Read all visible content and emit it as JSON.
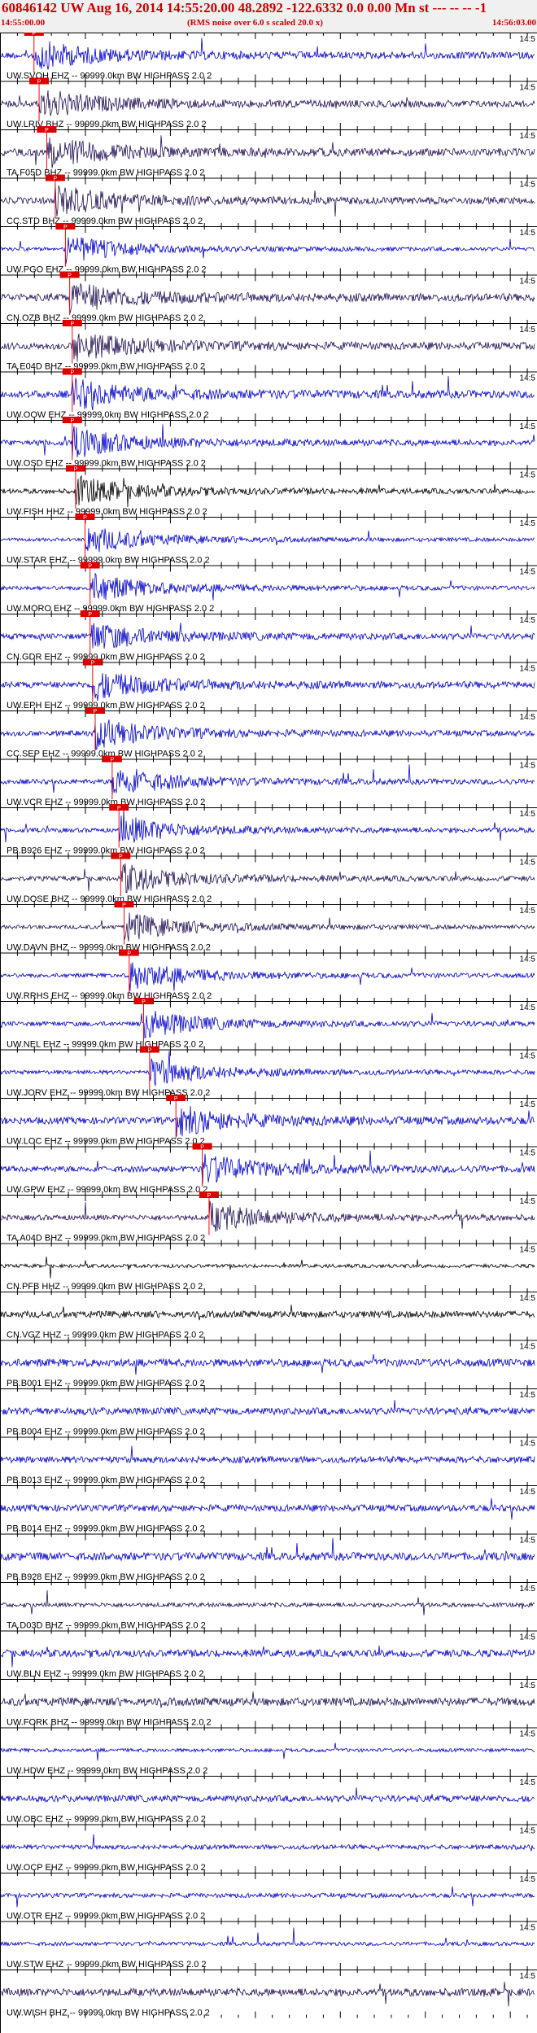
{
  "header": {
    "title": "60846142 UW Aug 16, 2014 14:55:20.00   48.2892 -122.6332  0.0 0.00 Mn st --- -- --  -1",
    "start_time": "14:55:00.00",
    "end_time": "14:56:03.00",
    "noise_note": "(RMS noise over 6.0 s scaled 20.0 x)"
  },
  "chart_data": {
    "type": "line",
    "title": "60846142 UW Aug 16, 2014 14:55:20.00   48.2892 -122.6332  0.0 0.00 Mn st --- -- --  -1",
    "x_range_seconds": [
      0,
      63
    ],
    "tick_label_right": "14:5",
    "filter": "HIGHPASS  2.0  2",
    "series": [
      {
        "label": "UW.SVOH EHZ -- 99999.0km BW  HIGHPASS  2.0  2",
        "color": "#0000cc",
        "pick_s": 4.0,
        "pick_label": "P"
      },
      {
        "label": "UW.LRIV BHZ -- 99999.0km BW  HIGHPASS  2.0  2",
        "color": "#221155",
        "pick_s": 4.6,
        "pick_label": "P"
      },
      {
        "label": "TA.F05D BHZ -- 99999.0km BW  HIGHPASS  2.0  2",
        "color": "#221155",
        "pick_s": 5.5,
        "pick_label": "P"
      },
      {
        "label": "CC.STD BHZ -- 99999.0km BW  HIGHPASS  2.0  2",
        "color": "#221155",
        "pick_s": 6.5,
        "pick_label": "P"
      },
      {
        "label": "UW.PGO EHZ -- 99999.0km BW  HIGHPASS  2.0  2",
        "color": "#0000cc",
        "pick_s": 7.7,
        "pick_label": "P"
      },
      {
        "label": "CN.OZB BHZ -- 99999.0km BW  HIGHPASS  2.0  2",
        "color": "#221155",
        "pick_s": 8.2,
        "pick_label": "P"
      },
      {
        "label": "TA.E04D BHZ -- 99999.0km BW  HIGHPASS  2.0  2",
        "color": "#221155",
        "pick_s": 8.5,
        "pick_label": "P"
      },
      {
        "label": "UW.OOW EHZ -- 99999.0km BW  HIGHPASS  2.0  2",
        "color": "#0000cc",
        "pick_s": 8.5,
        "pick_label": "P"
      },
      {
        "label": "UW.OSD EHZ -- 99999.0km BW  HIGHPASS  2.0  2",
        "color": "#0000cc",
        "pick_s": 8.5,
        "pick_label": "P"
      },
      {
        "label": "UW.FISH HHZ -- 99999.0km BW  HIGHPASS  2.0  2",
        "color": "#000000",
        "pick_s": 8.9,
        "pick_label": "P"
      },
      {
        "label": "UW.STAR EHZ -- 99999.0km BW  HIGHPASS  2.0  2",
        "color": "#0000cc",
        "pick_s": 10.0,
        "pick_label": "P"
      },
      {
        "label": "UW.MORO EHZ -- 99999.0km BW  HIGHPASS  2.0  2",
        "color": "#0000cc",
        "pick_s": 10.6,
        "pick_label": "P"
      },
      {
        "label": "CN.GDR EHZ -- 99999.0km BW  HIGHPASS  2.0  2",
        "color": "#0000cc",
        "pick_s": 10.6,
        "pick_label": "P"
      },
      {
        "label": "UW.EPH EHZ -- 99999.0km BW  HIGHPASS  2.0  2",
        "color": "#0000cc",
        "pick_s": 10.9,
        "pick_label": "P"
      },
      {
        "label": "CC.SEP EHZ -- 99999.0km BW  HIGHPASS  2.0  2",
        "color": "#0000cc",
        "pick_s": 11.2,
        "pick_label": "P"
      },
      {
        "label": "UW.VCR EHZ -- 99999.0km BW  HIGHPASS  2.0  2",
        "color": "#0000cc",
        "pick_s": 13.2,
        "pick_label": "P"
      },
      {
        "label": "PB.B926 EHZ -- 99999.0km BW  HIGHPASS  2.0  2",
        "color": "#0000cc",
        "pick_s": 14.0,
        "pick_label": "P"
      },
      {
        "label": "UW.DOSE BHZ -- 99999.0km BW  HIGHPASS  2.0  2",
        "color": "#221155",
        "pick_s": 14.2,
        "pick_label": "P"
      },
      {
        "label": "UW.DAVN BHZ -- 99999.0km BW  HIGHPASS  2.0  2",
        "color": "#221155",
        "pick_s": 14.6,
        "pick_label": "P"
      },
      {
        "label": "UW.RRHS EHZ -- 99999.0km BW  HIGHPASS  2.0  2",
        "color": "#0000cc",
        "pick_s": 15.2,
        "pick_label": "P"
      },
      {
        "label": "UW.NEL EHZ -- 99999.0km BW  HIGHPASS  2.0  2",
        "color": "#0000cc",
        "pick_s": 16.9,
        "pick_label": "P"
      },
      {
        "label": "UW.JORV EHZ -- 99999.0km BW  HIGHPASS  2.0  2",
        "color": "#0000cc",
        "pick_s": 17.6,
        "pick_label": "P"
      },
      {
        "label": "UW.LOC EHZ -- 99999.0km BW  HIGHPASS  2.0  2",
        "color": "#0000cc",
        "pick_s": 20.7,
        "pick_label": "P"
      },
      {
        "label": "UW.GPW EHZ -- 99999.0km BW  HIGHPASS  2.0  2",
        "color": "#0000cc",
        "pick_s": 23.8,
        "pick_label": "P"
      },
      {
        "label": "TA.A04D BHZ -- 99999.0km BW  HIGHPASS  2.0  2",
        "color": "#221155",
        "pick_s": 24.6,
        "pick_label": "P"
      },
      {
        "label": "CN.PFB HHZ -- 99999.0km BW  HIGHPASS  2.0  2",
        "color": "#000000",
        "pick_s": null
      },
      {
        "label": "CN.VGZ HHZ -- 99999.0km BW  HIGHPASS  2.0  2",
        "color": "#000000",
        "pick_s": null
      },
      {
        "label": "PB.B001 EHZ -- 99999.0km BW  HIGHPASS  2.0  2",
        "color": "#0000cc",
        "pick_s": null
      },
      {
        "label": "PB.B004 EHZ -- 99999.0km BW  HIGHPASS  2.0  2",
        "color": "#0000cc",
        "pick_s": null
      },
      {
        "label": "PB.B013 EHZ -- 99999.0km BW  HIGHPASS  2.0  2",
        "color": "#0000cc",
        "pick_s": null
      },
      {
        "label": "PB.B014 EHZ -- 99999.0km BW  HIGHPASS  2.0  2",
        "color": "#0000cc",
        "pick_s": null
      },
      {
        "label": "PB.B928 EHZ -- 99999.0km BW  HIGHPASS  2.0  2",
        "color": "#0000cc",
        "pick_s": null
      },
      {
        "label": "TA.D03D BHZ -- 99999.0km BW  HIGHPASS  2.0  2",
        "color": "#221155",
        "pick_s": null
      },
      {
        "label": "UW.BLN EHZ -- 99999.0km BW  HIGHPASS  2.0  2",
        "color": "#0000cc",
        "pick_s": null
      },
      {
        "label": "UW.FORK BHZ -- 99999.0km BW  HIGHPASS  2.0  2",
        "color": "#221155",
        "pick_s": null
      },
      {
        "label": "UW.HDW EHZ -- 99999.0km BW  HIGHPASS  2.0  2",
        "color": "#0000cc",
        "pick_s": null
      },
      {
        "label": "UW.OBC EHZ -- 99999.0km BW  HIGHPASS  2.0  2",
        "color": "#0000cc",
        "pick_s": null
      },
      {
        "label": "UW.OCP EHZ -- 99999.0km BW  HIGHPASS  2.0  2",
        "color": "#0000cc",
        "pick_s": null
      },
      {
        "label": "UW.OTR EHZ -- 99999.0km BW  HIGHPASS  2.0  2",
        "color": "#0000cc",
        "pick_s": null
      },
      {
        "label": "UW.STW EHZ -- 99999.0km BW  HIGHPASS  2.0  2",
        "color": "#0000cc",
        "pick_s": null
      },
      {
        "label": "UW.WISH BHZ -- 99999.0km BW  HIGHPASS  2.0  2",
        "color": "#221155",
        "pick_s": null
      }
    ]
  }
}
